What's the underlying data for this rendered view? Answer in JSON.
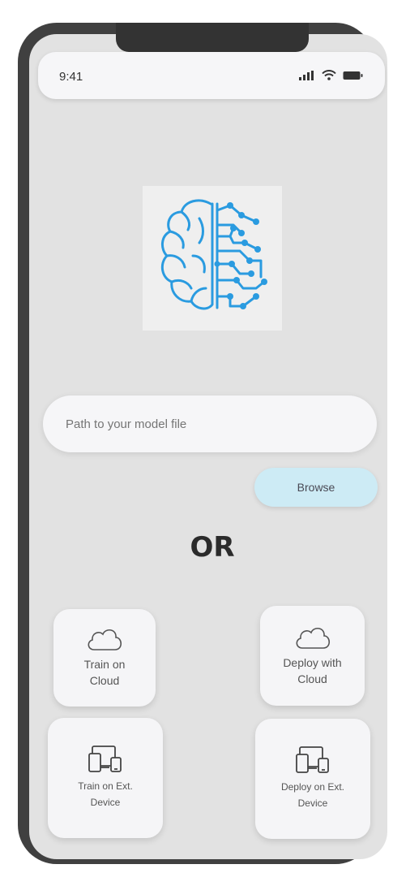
{
  "status": {
    "time": "9:41",
    "icons": [
      "signal-icon",
      "wifi-icon",
      "battery-icon"
    ]
  },
  "logo": {
    "icon": "brain-circuit-icon",
    "color": "#2a9be0"
  },
  "model_path": {
    "placeholder": "Path to your model file",
    "value": ""
  },
  "browse": {
    "label": "Browse",
    "color": "#cdebf5"
  },
  "divider": {
    "label": "OR"
  },
  "options": [
    {
      "label": "Train on\nCloud",
      "icon": "cloud-icon"
    },
    {
      "label": "Deploy with\nCloud",
      "icon": "cloud-icon"
    },
    {
      "label": "Train on Ext.\nDevice",
      "icon": "devices-icon"
    },
    {
      "label": "Deploy on Ext.\nDevice",
      "icon": "devices-icon"
    }
  ]
}
